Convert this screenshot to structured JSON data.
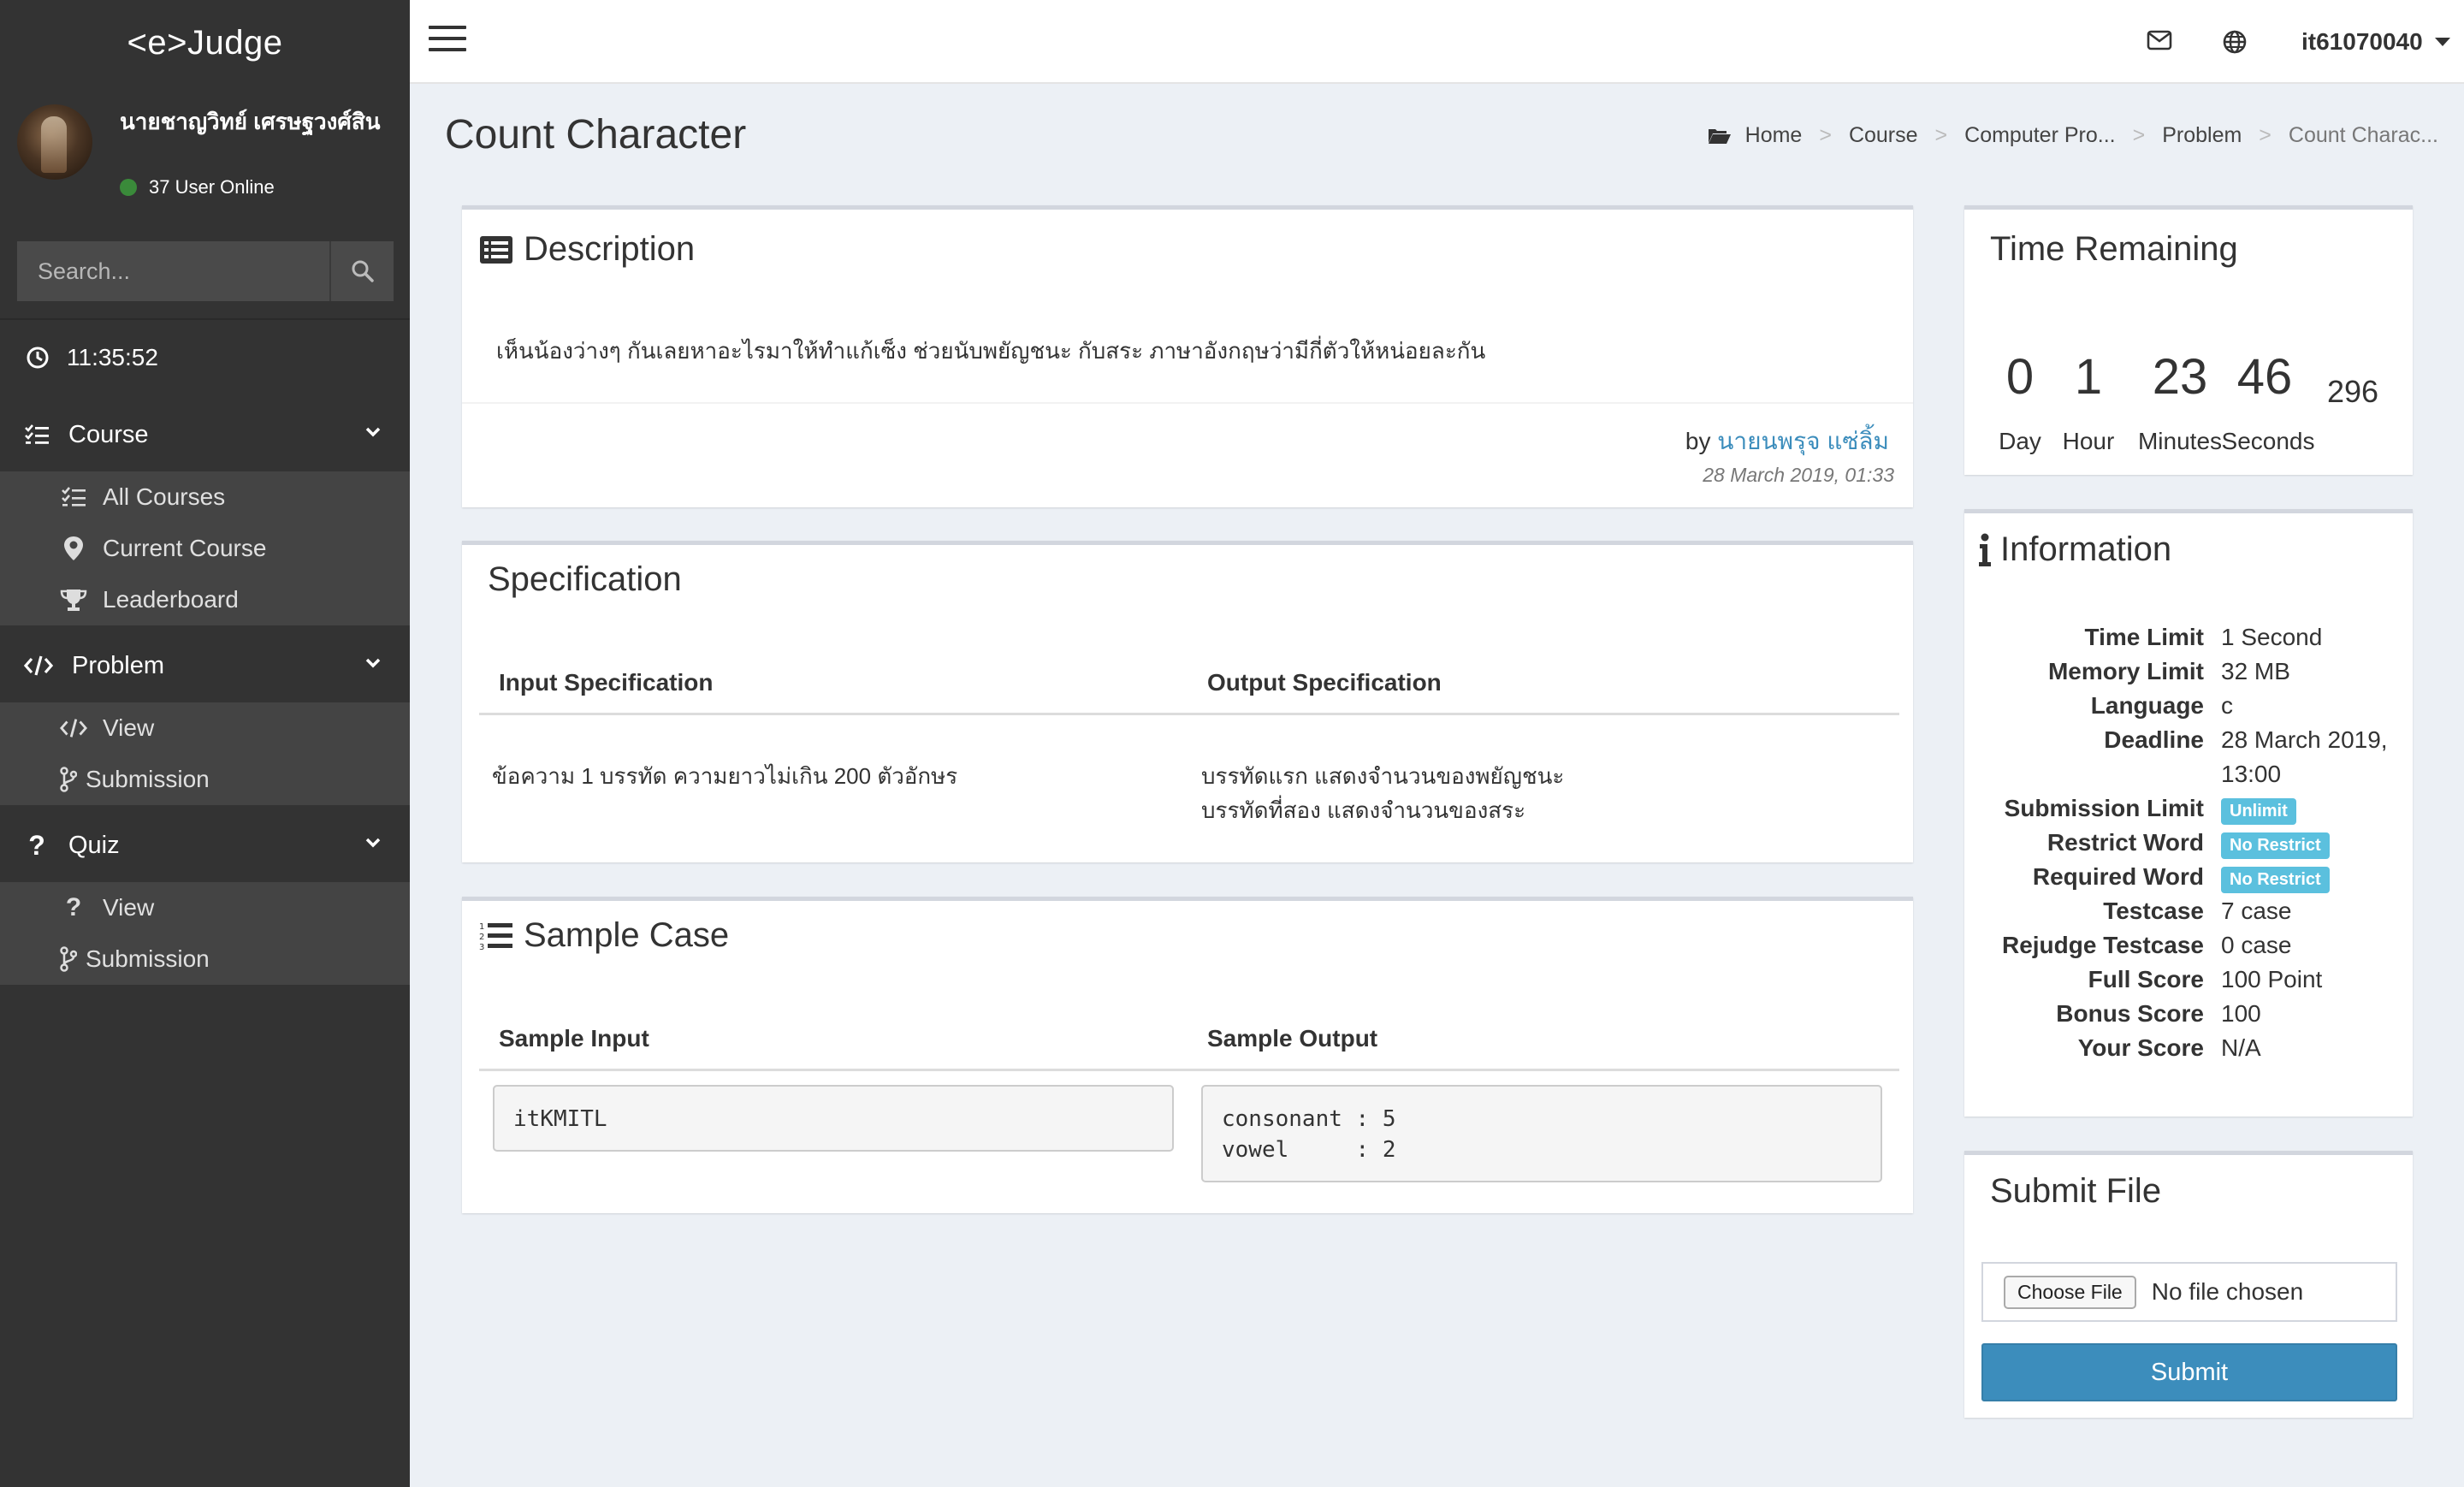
{
  "app": {
    "logo": "<e>Judge"
  },
  "user": {
    "name": "นายชาญวิทย์ เศรษฐวงศ์สิน",
    "online": "37 User Online"
  },
  "search": {
    "placeholder": "Search..."
  },
  "clock": "11:35:52",
  "sidebar": {
    "course": {
      "label": "Course",
      "items": [
        "All Courses",
        "Current Course",
        "Leaderboard"
      ]
    },
    "problem": {
      "label": "Problem",
      "items": [
        "View",
        "Submission"
      ]
    },
    "quiz": {
      "label": "Quiz",
      "items": [
        "View",
        "Submission"
      ]
    }
  },
  "topbar": {
    "username": "it61070040"
  },
  "page": {
    "title": "Count Character"
  },
  "breadcrumb": [
    "Home",
    "Course",
    "Computer Pro...",
    "Problem",
    "Count Charac..."
  ],
  "description": {
    "title": "Description",
    "text": "เห็นน้องว่างๆ กันเลยหาอะไรมาให้ทำแก้เซ็ง ช่วยนับพยัญชนะ กับสระ ภาษาอังกฤษว่ามีกี่ตัวให้หน่อยละกัน",
    "by_label": "by",
    "author": "นายนพรุจ แซ่ลิ้ม",
    "date": "28 March 2019, 01:33"
  },
  "specification": {
    "title": "Specification",
    "input_header": "Input Specification",
    "output_header": "Output Specification",
    "input_text": "ข้อความ 1 บรรทัด ความยาวไม่เกิน 200 ตัวอักษร",
    "output_line1": "บรรทัดแรก แสดงจำนวนของพยัญชนะ",
    "output_line2": "บรรทัดที่สอง แสดงจำนวนของสระ"
  },
  "sample": {
    "title": "Sample Case",
    "input_header": "Sample Input",
    "output_header": "Sample Output",
    "input": "itKMITL",
    "output": "consonant : 5\nvowel     : 2"
  },
  "time_remaining": {
    "title": "Time Remaining",
    "day": "0",
    "hour": "1",
    "minutes": "23",
    "seconds": "46",
    "ms": "296",
    "day_label": "Day",
    "hour_label": "Hour",
    "minutes_label": "Minutes",
    "seconds_label": "Seconds"
  },
  "information": {
    "title": "Information",
    "time_limit_k": "Time Limit",
    "time_limit_v": "1 Second",
    "memory_limit_k": "Memory Limit",
    "memory_limit_v": "32 MB",
    "language_k": "Language",
    "language_v": "c",
    "deadline_k": "Deadline",
    "deadline_v1": "28 March 2019,",
    "deadline_v2": "13:00",
    "submission_limit_k": "Submission Limit",
    "submission_limit_v": "Unlimit",
    "restrict_word_k": "Restrict Word",
    "restrict_word_v": "No Restrict",
    "required_word_k": "Required Word",
    "required_word_v": "No Restrict",
    "testcase_k": "Testcase",
    "testcase_v": "7 case",
    "rejudge_k": "Rejudge Testcase",
    "rejudge_v": "0 case",
    "full_score_k": "Full Score",
    "full_score_v": "100 Point",
    "bonus_score_k": "Bonus Score",
    "bonus_score_v": "100",
    "your_score_k": "Your Score",
    "your_score_v": "N/A"
  },
  "submit": {
    "title": "Submit File",
    "choose_label": "Choose File",
    "no_file": "No file chosen",
    "button": "Submit"
  },
  "colors": {
    "sidebar": "#333333",
    "submenu": "#444444",
    "primary": "#3c8dbc",
    "badge": "#5bc0de"
  }
}
